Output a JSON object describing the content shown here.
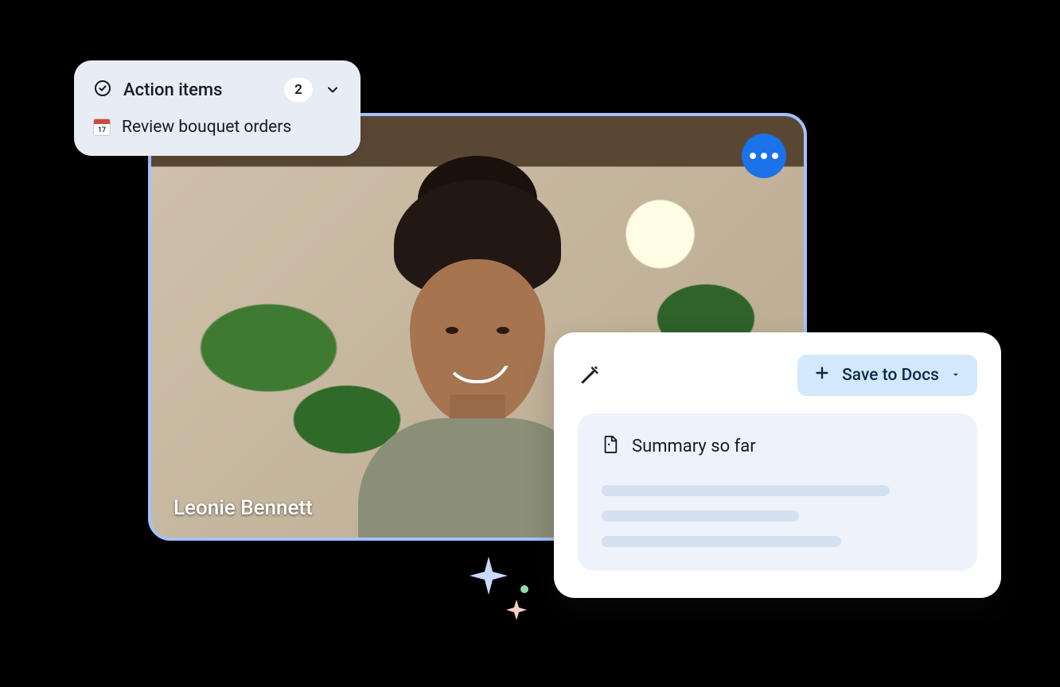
{
  "video": {
    "participant_name": "Leonie Bennett"
  },
  "action_items": {
    "title": "Action items",
    "count": "2",
    "items": [
      {
        "label": "Review bouquet orders"
      }
    ]
  },
  "summary": {
    "save_button_label": "Save to Docs",
    "title": "Summary so far"
  }
}
